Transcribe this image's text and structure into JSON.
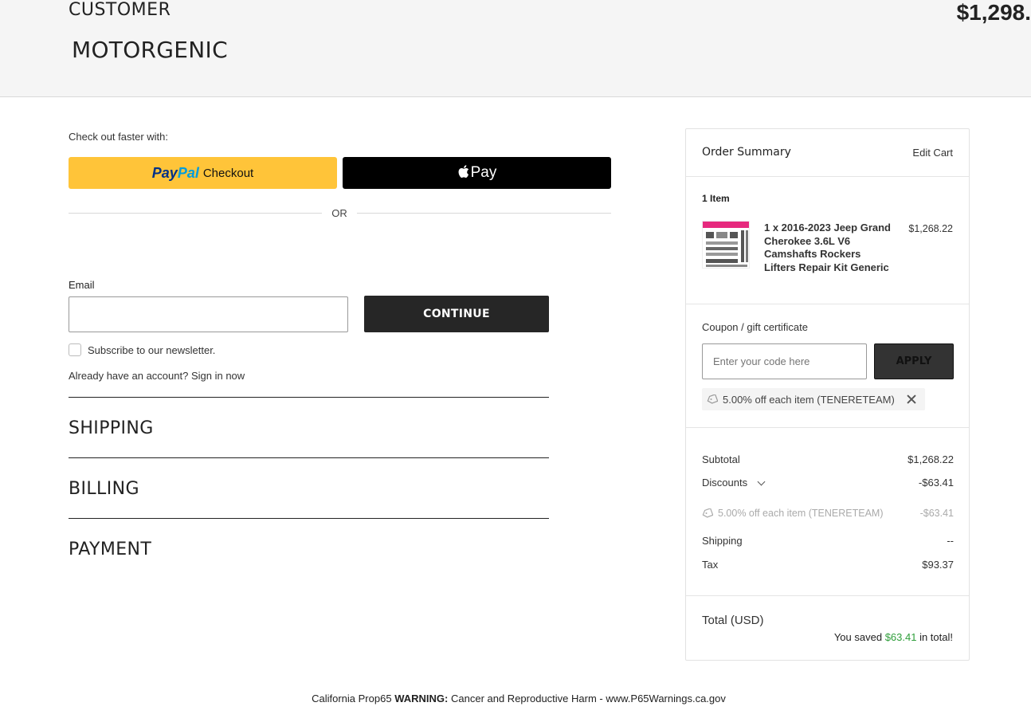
{
  "header": {
    "section_label": "CUSTOMER",
    "brand": "MOTORGENIC",
    "total": "$1,298."
  },
  "checkout": {
    "faster_label": "Check out faster with:",
    "paypal_label": "Checkout",
    "paypal_logo_part1": "Pay",
    "paypal_logo_part2": "Pal",
    "applepay_label": "Pay",
    "or_label": "OR"
  },
  "customer": {
    "email_label": "Email",
    "email_value": "",
    "continue_label": "CONTINUE",
    "subscribe_label": "Subscribe to our newsletter.",
    "account_text": "Already have an account?",
    "sign_in_label": "Sign in now"
  },
  "sections": [
    {
      "title": "SHIPPING"
    },
    {
      "title": "BILLING"
    },
    {
      "title": "PAYMENT"
    }
  ],
  "summary": {
    "title": "Order Summary",
    "edit_cart_label": "Edit Cart",
    "item_count": "1 Item",
    "product": {
      "name": "1 x 2016-2023 Jeep Grand Cherokee 3.6L V6 Camshafts Rockers Lifters Repair Kit Generic",
      "price": "$1,268.22"
    },
    "coupon": {
      "label": "Coupon / gift certificate",
      "placeholder": "Enter your code here",
      "apply_label": "APPLY",
      "applied_tag": "5.00% off each item (TENERETEAM)"
    },
    "subtotal_label": "Subtotal",
    "subtotal_value": "$1,268.22",
    "discounts_label": "Discounts",
    "discounts_value": "-$63.41",
    "discount_detail_label": "5.00% off each item (TENERETEAM)",
    "discount_detail_value": "-$63.41",
    "shipping_label": "Shipping",
    "shipping_value": "--",
    "tax_label": "Tax",
    "tax_value": "$93.37",
    "total_label": "Total (USD)",
    "saved_prefix": "You saved",
    "saved_amount": "$63.41",
    "saved_suffix": "in total!"
  },
  "footer": {
    "prefix": "California Prop65",
    "warning": "WARNING:",
    "suffix": "Cancer and Reproductive Harm - www.P65Warnings.ca.gov"
  },
  "colors": {
    "paypal_yellow": "#ffc439",
    "dark_button": "#262626",
    "savings_green": "#2e9e3a"
  }
}
